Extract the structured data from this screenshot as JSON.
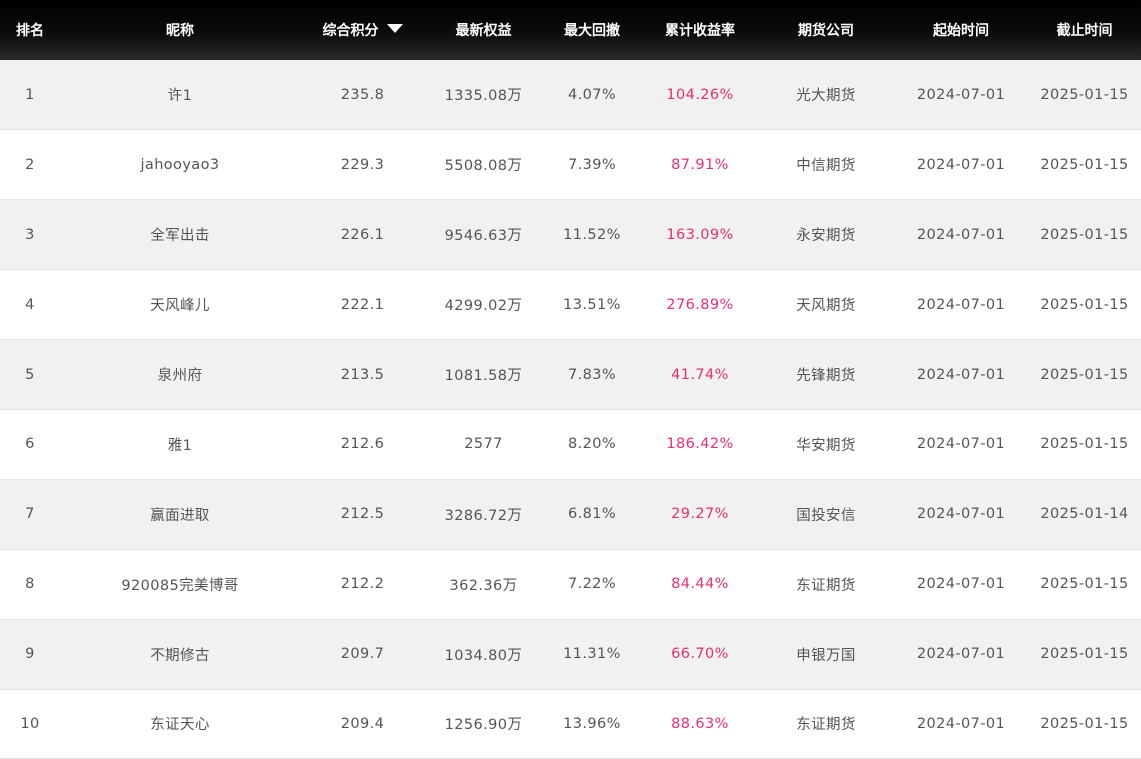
{
  "accent_color": "#e8306f",
  "header_color": "#000000",
  "table": {
    "columns": [
      "排名",
      "昵称",
      "综合积分",
      "最新权益",
      "最大回撤",
      "累计收益率",
      "期货公司",
      "起始时间",
      "截止时间"
    ],
    "sort_icon": "caret-down-icon",
    "rows": [
      [
        "1",
        "许1",
        "235.8",
        "1335.08万",
        "4.07%",
        "104.26%",
        "光大期货",
        "2024-07-01",
        "2025-01-15"
      ],
      [
        "2",
        "jahooyao3",
        "229.3",
        "5508.08万",
        "7.39%",
        "87.91%",
        "中信期货",
        "2024-07-01",
        "2025-01-15"
      ],
      [
        "3",
        "全军出击",
        "226.1",
        "9546.63万",
        "11.52%",
        "163.09%",
        "永安期货",
        "2024-07-01",
        "2025-01-15"
      ],
      [
        "4",
        "天风峰儿",
        "222.1",
        "4299.02万",
        "13.51%",
        "276.89%",
        "天风期货",
        "2024-07-01",
        "2025-01-15"
      ],
      [
        "5",
        "泉州府",
        "213.5",
        "1081.58万",
        "7.83%",
        "41.74%",
        "先锋期货",
        "2024-07-01",
        "2025-01-15"
      ],
      [
        "6",
        "雅1",
        "212.6",
        "2577",
        "8.20%",
        "186.42%",
        "华安期货",
        "2024-07-01",
        "2025-01-15"
      ],
      [
        "7",
        "赢面进取",
        "212.5",
        "3286.72万",
        "6.81%",
        "29.27%",
        "国投安信",
        "2024-07-01",
        "2025-01-14"
      ],
      [
        "8",
        "920085完美博哥",
        "212.2",
        "362.36万",
        "7.22%",
        "84.44%",
        "东证期货",
        "2024-07-01",
        "2025-01-15"
      ],
      [
        "9",
        "不期修古",
        "209.7",
        "1034.80万",
        "11.31%",
        "66.70%",
        "申银万国",
        "2024-07-01",
        "2025-01-15"
      ],
      [
        "10",
        "东证天心",
        "209.4",
        "1256.90万",
        "13.96%",
        "88.63%",
        "东证期货",
        "2024-07-01",
        "2025-01-15"
      ]
    ]
  }
}
